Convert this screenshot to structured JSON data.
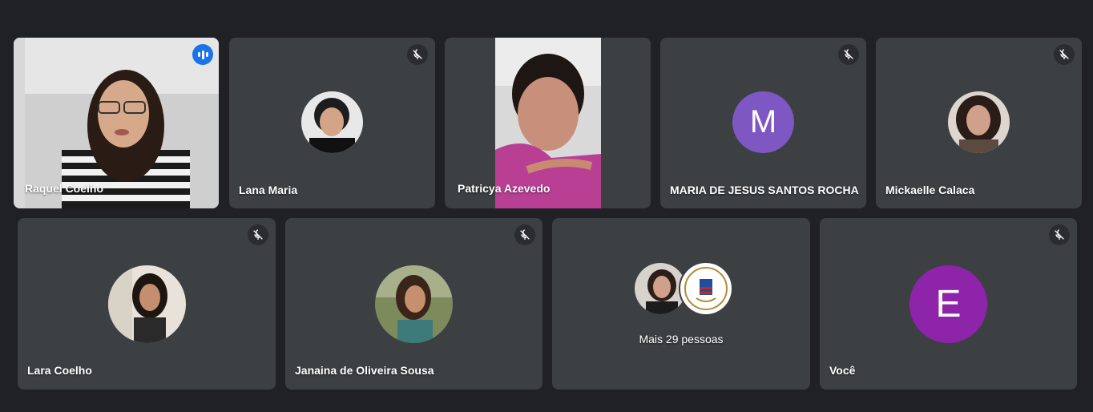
{
  "participants": [
    {
      "name": "Raquel Coelho",
      "speaking": true
    },
    {
      "name": "Lana Maria",
      "muted": true
    },
    {
      "name": "Patricya Azevedo",
      "muted": false
    },
    {
      "name": "MARIA DE JESUS SANTOS ROCHA",
      "muted": true,
      "initial": "M",
      "avatar_color": "#7e57c2"
    },
    {
      "name": "Mickaelle Calaca",
      "muted": true
    },
    {
      "name": "Lara Coelho",
      "muted": true
    },
    {
      "name": "Janaina de Oliveira Sousa",
      "muted": true
    },
    {
      "name": "Você",
      "muted": true,
      "initial": "E",
      "avatar_color": "#8e24aa"
    }
  ],
  "overflow": {
    "label": "Mais 29 pessoas"
  },
  "colors": {
    "background": "#202124",
    "tile": "#3c4043",
    "active_border": "#8ab4f8",
    "speaking_badge": "#1a73e8"
  },
  "icons": {
    "muted": "mic-off-icon",
    "speaking": "audio-wave-icon"
  }
}
